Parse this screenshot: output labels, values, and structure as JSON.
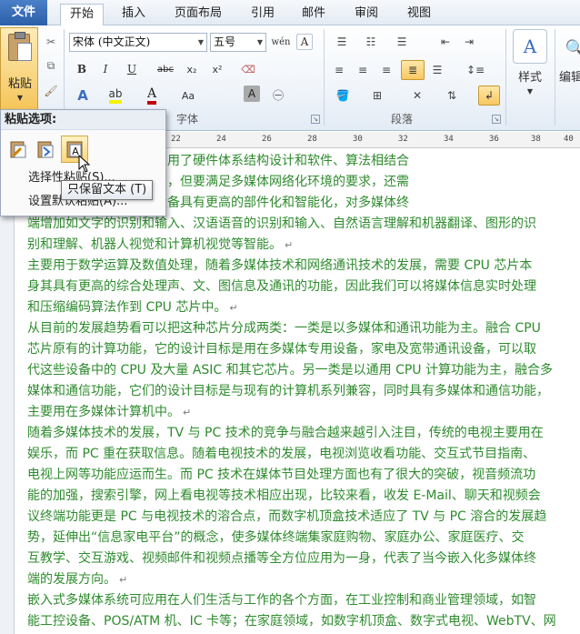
{
  "tabs": {
    "file": "文件",
    "home": "开始",
    "insert": "插入",
    "page_layout": "页面布局",
    "references": "引用",
    "mailings": "邮件",
    "review": "审阅",
    "view": "视图"
  },
  "clipboard": {
    "paste_label": "粘贴"
  },
  "font": {
    "name": "宋体 (中文正文)",
    "size": "五号",
    "group_label": "字体",
    "bold": "B",
    "italic": "I",
    "underline": "U",
    "strikethrough": "abc",
    "subscript": "x₂",
    "superscript": "x²",
    "grow": "A",
    "shrink": "A",
    "case": "Aa",
    "clear": "A",
    "phonetic": "wén",
    "border": "A",
    "highlight": "A",
    "shading": "A"
  },
  "paragraph": {
    "group_label": "段落"
  },
  "styles": {
    "label": "样式",
    "sample": "A"
  },
  "editing": {
    "label": "编辑"
  },
  "ruler": {
    "ticks": [
      "22",
      "24",
      "26",
      "28",
      "30",
      "32",
      "34",
      "36",
      "38",
      "40"
    ]
  },
  "paste_menu": {
    "header": "粘贴选项:",
    "item_select": "选择性粘贴(S)...",
    "item_default": "设置默认粘贴(A)...",
    "tooltip": "只保留文本 (T)",
    "keep_text_glyph": "A"
  },
  "document": {
    "lines": [
      {
        "text": "软件不断改进，尤其是采用了硬件体系结构设计和软件、算法相结合",
        "color": "green",
        "mark": false
      },
      {
        "text": "机的性能指标进一步提高，但要满足多媒体网络化环境的要求，还需",
        "color": "green",
        "mark": false
      },
      {
        "text": "和研究，使多媒体终端设备具有更高的部件化和智能化，对多媒体终",
        "color": "green",
        "mark": false
      },
      {
        "text": "端增加如文字的识别和输入、汉语语音的识别和输入、自然语言理解和机器翻译、图形的识",
        "color": "green",
        "mark": false
      },
      {
        "text": "别和理解、机器人视觉和计算机视觉等智能。",
        "color": "green",
        "mark": true
      },
      {
        "text": "主要用于数学运算及数值处理，随着多媒体技术和网络通讯技术的发展，需要 CPU 芯片本",
        "color": "green",
        "mark": false
      },
      {
        "text": "身其具有更高的综合处理声、文、图信息及通讯的功能，因此我们可以将媒体信息实时处理",
        "color": "green",
        "mark": false
      },
      {
        "text": "和压缩编码算法作到 CPU 芯片中。",
        "color": "green",
        "mark": true
      },
      {
        "text": "从目前的发展趋势看可以把这种芯片分成两类：一类是以多媒体和通讯功能为主。融合 CPU",
        "color": "green",
        "mark": false
      },
      {
        "text": "芯片原有的计算功能，它的设计目标是用在多媒体专用设备，家电及宽带通讯设备，可以取",
        "color": "green",
        "mark": false
      },
      {
        "text": "代这些设备中的 CPU 及大量 ASIC 和其它芯片。另一类是以通用 CPU 计算功能为主，融合多",
        "color": "green",
        "mark": false
      },
      {
        "text": "媒体和通信功能，它们的设计目标是与现有的计算机系列兼容，同时具有多媒体和通信功能，",
        "color": "green",
        "mark": false
      },
      {
        "text": "主要用在多媒体计算机中。",
        "color": "green",
        "mark": true
      },
      {
        "text": "随着多媒体技术的发展，TV 与 PC 技术的竞争与融合越来越引入注目，传统的电视主要用在",
        "color": "green",
        "mark": false
      },
      {
        "text": "娱乐，而 PC 重在获取信息。随着电视技术的发展，电视浏览收看功能、交互式节目指南、",
        "color": "green",
        "mark": false
      },
      {
        "text": "电视上网等功能应运而生。而 PC 技术在媒体节目处理方面也有了很大的突破，视音频流功",
        "color": "green",
        "mark": false
      },
      {
        "text": "能的加强，搜索引擎，网上看电视等技术相应出现，比较来看，收发 E-Mail、聊天和视频会",
        "color": "green",
        "mark": false
      },
      {
        "text": "议终端功能更是 PC 与电视技术的溶合点，而数字机顶盒技术适应了 TV 与 PC 溶合的发展趋",
        "color": "green",
        "mark": false
      },
      {
        "text": "势，延伸出“信息家电平台”的概念，使多媒体终端集家庭购物、家庭办公、家庭医疗、交",
        "color": "green",
        "mark": false
      },
      {
        "text": "互教学、交互游戏、视频邮件和视频点播等全方位应用为一身，代表了当今嵌入化多媒体终",
        "color": "green",
        "mark": false
      },
      {
        "text": "端的发展方向。",
        "color": "green",
        "mark": true
      },
      {
        "text": "嵌入式多媒体系统可应用在人们生活与工作的各个方面，在工业控制和商业管理领域，如智",
        "color": "green",
        "mark": false
      },
      {
        "text": "能工控设备、POS/ATM 机、IC 卡等；在家庭领域，如数字机顶盒、数字式电视、WebTV、网",
        "color": "green",
        "mark": false
      }
    ]
  }
}
